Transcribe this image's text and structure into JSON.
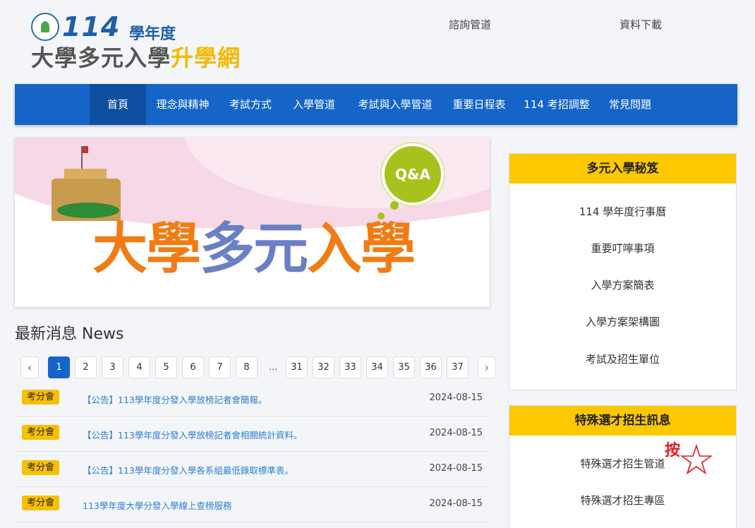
{
  "header": {
    "logo_year": "114",
    "logo_year_suffix": "學年度",
    "logo_title_main": "大學多元入學",
    "logo_title_accent": "升學網",
    "top_links": [
      "諮詢管道",
      "資料下載"
    ]
  },
  "nav": {
    "items": [
      "首頁",
      "理念與精神",
      "考試方式",
      "入學管道",
      "考試與入學管道",
      "重要日程表",
      "114 考招調整",
      "常見問題"
    ],
    "active_index": 0
  },
  "banner": {
    "title_part1": "大學",
    "title_part2": "多元",
    "title_part3": "入學",
    "qa_label": "Q&A"
  },
  "news": {
    "heading": "最新消息 News",
    "pagination": {
      "prev_icon": "chevron-left-icon",
      "next_icon": "chevron-right-icon",
      "pages_start": [
        "1",
        "2",
        "3",
        "4",
        "5",
        "6",
        "7",
        "8"
      ],
      "ellipsis": "...",
      "pages_end": [
        "31",
        "32",
        "33",
        "34",
        "35",
        "36",
        "37"
      ],
      "active": "1"
    },
    "items": [
      {
        "badge": "考分會",
        "title": "【公告】113學年度分發入學放榜記者會簡報。",
        "date": "2024-08-15"
      },
      {
        "badge": "考分會",
        "title": "【公告】113學年度分發入學放榜記者會相關統計資料。",
        "date": "2024-08-15"
      },
      {
        "badge": "考分會",
        "title": "【公告】113學年度分發入學各系組最低錄取標準表。",
        "date": "2024-08-15"
      },
      {
        "badge": "考分會",
        "title": "113學年度大學分發入學線上查榜服務",
        "date": "2024-08-15"
      }
    ]
  },
  "sidebar": {
    "panel1": {
      "title": "多元入學秘笈",
      "items": [
        "114 學年度行事曆",
        "重要叮嚀事項",
        "入學方案簡表",
        "入學方案架構圖",
        "考試及招生單位"
      ]
    },
    "panel2": {
      "title": "特殊選才招生訊息",
      "items": [
        "特殊選才招生管道",
        "特殊選才招生專區"
      ]
    }
  },
  "annotation": {
    "text": "按",
    "star": "☆"
  },
  "colors": {
    "nav_bg": "#1565c8",
    "accent_yellow": "#fcc800",
    "link_blue": "#2d7fcf",
    "annotation_red": "#e31b23"
  }
}
